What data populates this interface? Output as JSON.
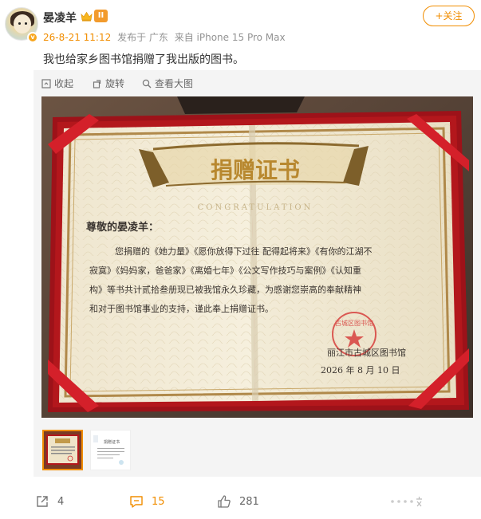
{
  "user": {
    "name": "晏凌羊",
    "level": "II",
    "verified_mark": "v"
  },
  "meta": {
    "date": "26-8-21 11:12",
    "location": "发布于 广东",
    "device": "来自 iPhone 15 Pro Max"
  },
  "follow": {
    "label": "+关注"
  },
  "post": {
    "text": "我也给家乡图书馆捐赠了我出版的图书。"
  },
  "tools": {
    "collapse": "收起",
    "rotate": "旋转",
    "view_large": "查看大图"
  },
  "certificate": {
    "title": "捐赠证书",
    "subtitle": "CONGRATULATION",
    "salutation": "尊敬的晏凌羊：",
    "body_lines": [
      "您捐赠的《她力量》《愿你放得下过往 配得起将来》《有你的江湖不",
      "寂寞》《妈妈家，爸爸家》《离婚七年》《公文写作技巧与案例》《认知重",
      "构》等书共计贰拾叁册现已被我馆永久珍藏，为感谢您崇高的奉献精神",
      "和对于图书馆事业的支持，谨此奉上捐赠证书。"
    ],
    "issuer": "丽江市古城区图书馆",
    "date": "2026 年 8 月 10 日",
    "seal_text": "古城区图书馆"
  },
  "thumb2": {
    "title": "捐赠证书"
  },
  "actions": {
    "share_count": "4",
    "comment_count": "15",
    "like_count": "281"
  },
  "colors": {
    "accent": "#f18d00",
    "certificate_red": "#b3171c",
    "gold": "#8c6a2e"
  },
  "icons": [
    "crown-icon",
    "collapse-icon",
    "rotate-icon",
    "zoom-icon",
    "share-icon",
    "comment-icon",
    "like-icon",
    "more-icon"
  ]
}
